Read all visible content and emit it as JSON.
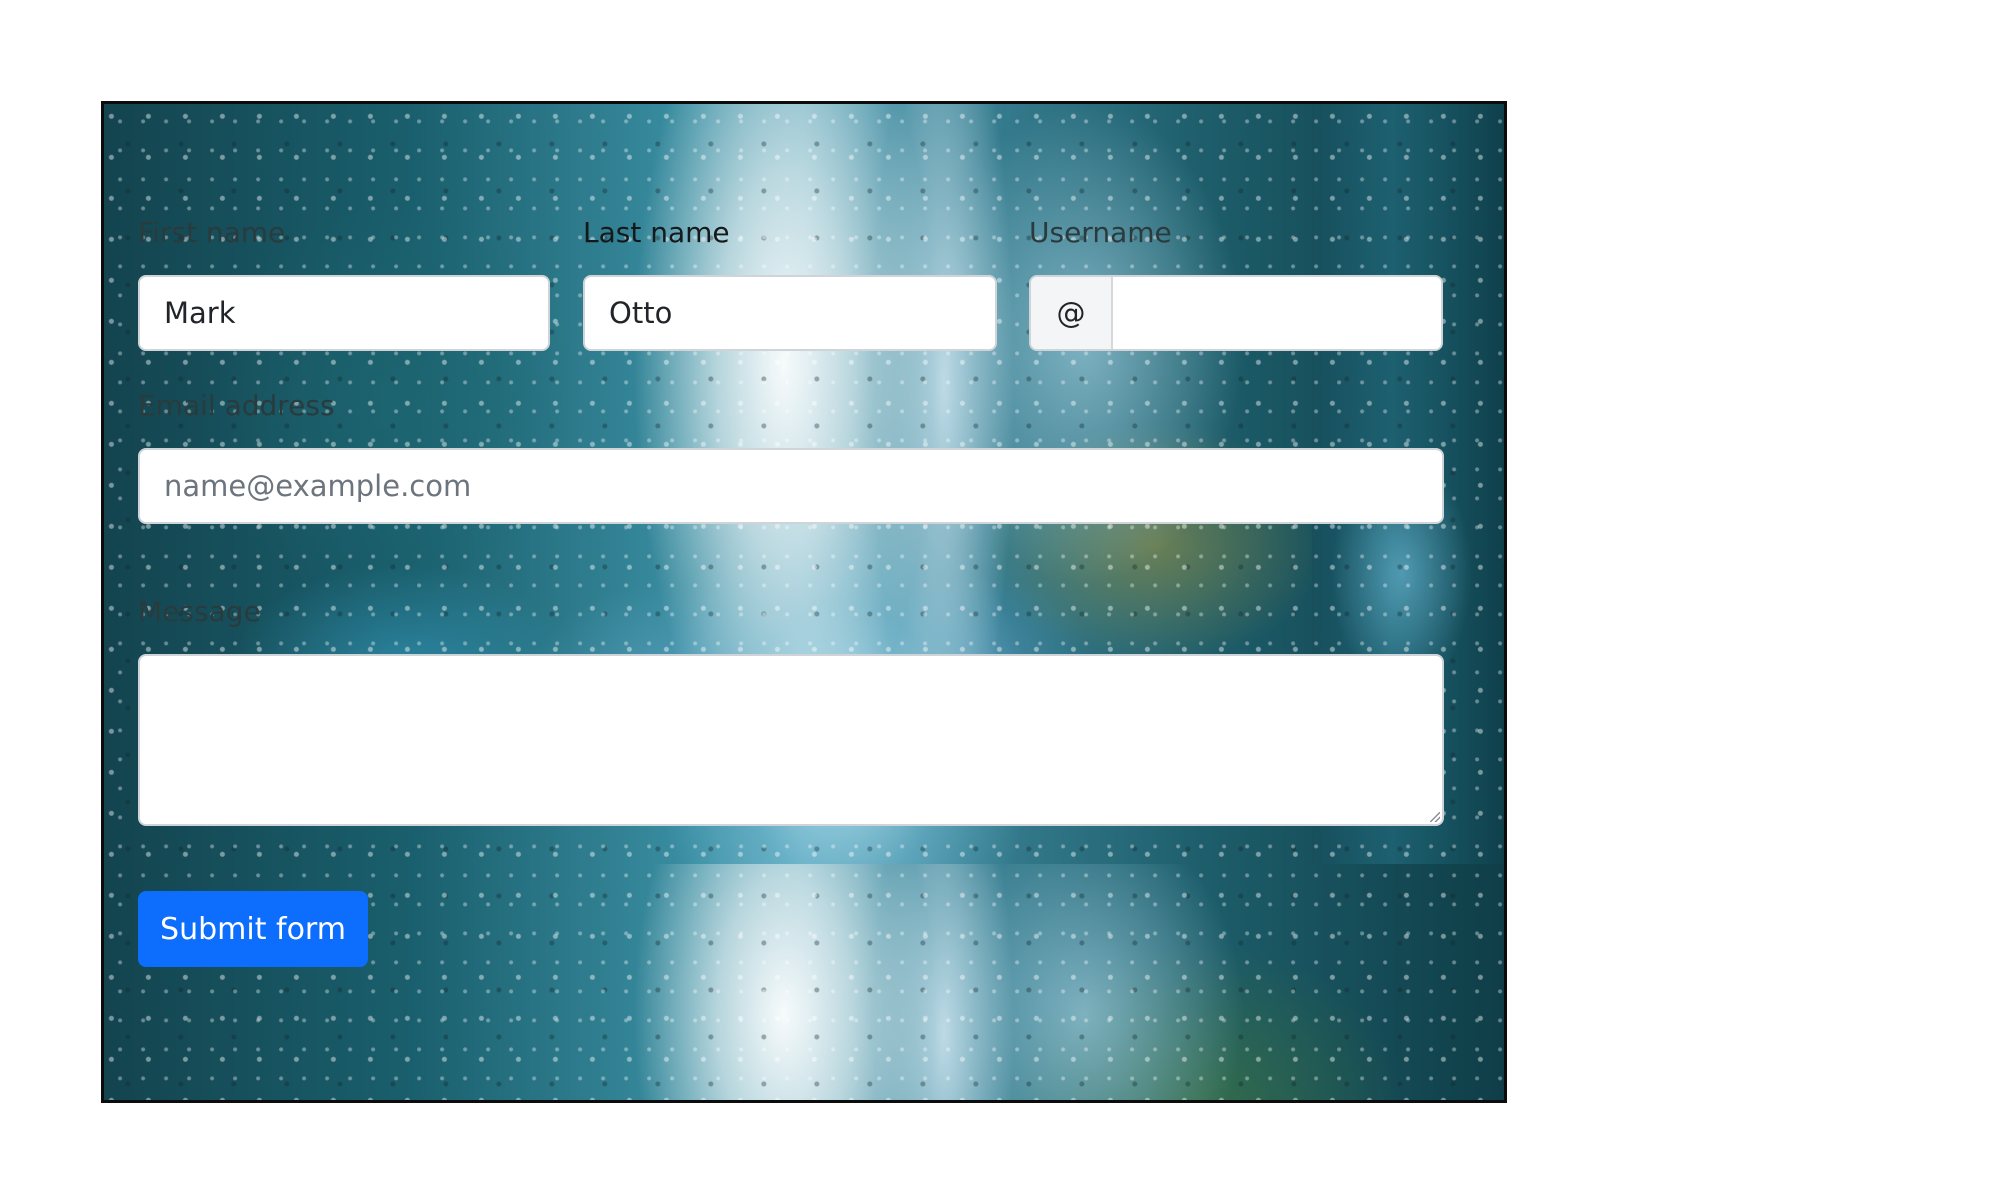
{
  "form": {
    "first_name": {
      "label": "First name",
      "value": "Mark"
    },
    "last_name": {
      "label": "Last name",
      "value": "Otto"
    },
    "username": {
      "label": "Username",
      "prefix": "@",
      "value": ""
    },
    "email": {
      "label": "Email address",
      "placeholder": "name@example.com",
      "value": ""
    },
    "message": {
      "label": "Message",
      "value": ""
    },
    "submit_label": "Submit form"
  },
  "colors": {
    "button": "#0d6efd",
    "frame_border": "#0c0c0c",
    "input_border": "#cfd4d9"
  }
}
